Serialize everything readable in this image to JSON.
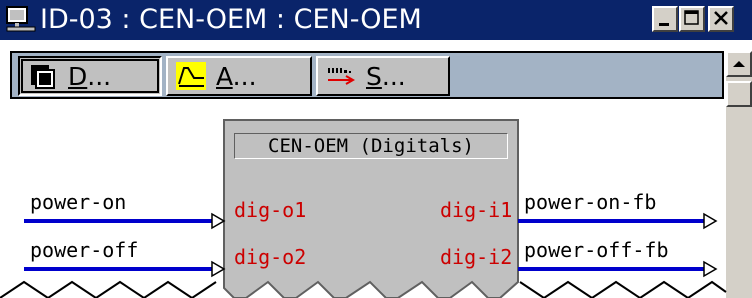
{
  "window": {
    "title": "ID-03 : CEN-OEM : CEN-OEM",
    "controls": {
      "minimize": "minimize",
      "maximize": "maximize",
      "close": "close"
    }
  },
  "toolbar": {
    "buttons": [
      {
        "underline": "D",
        "rest": "...",
        "icon": "digitals-icon",
        "pressed": true
      },
      {
        "underline": "A",
        "rest": "...",
        "icon": "analogs-icon",
        "pressed": false
      },
      {
        "underline": "S",
        "rest": "...",
        "icon": "serials-icon",
        "pressed": false
      }
    ]
  },
  "block": {
    "title": "CEN-OEM (Digitals)",
    "outputs": [
      "dig-o1",
      "dig-o2"
    ],
    "inputs": [
      "dig-i1",
      "dig-i2"
    ]
  },
  "signals": {
    "left": [
      "power-on",
      "power-off"
    ],
    "right": [
      "power-on-fb",
      "power-off-fb"
    ]
  },
  "colors": {
    "titlebar": "#0a246a",
    "toolbar": "#a3b3c5",
    "wire": "#0000cc",
    "pin_text": "#cc0000",
    "block_fill": "#c0c0c0",
    "analog_highlight": "#ffff00"
  }
}
